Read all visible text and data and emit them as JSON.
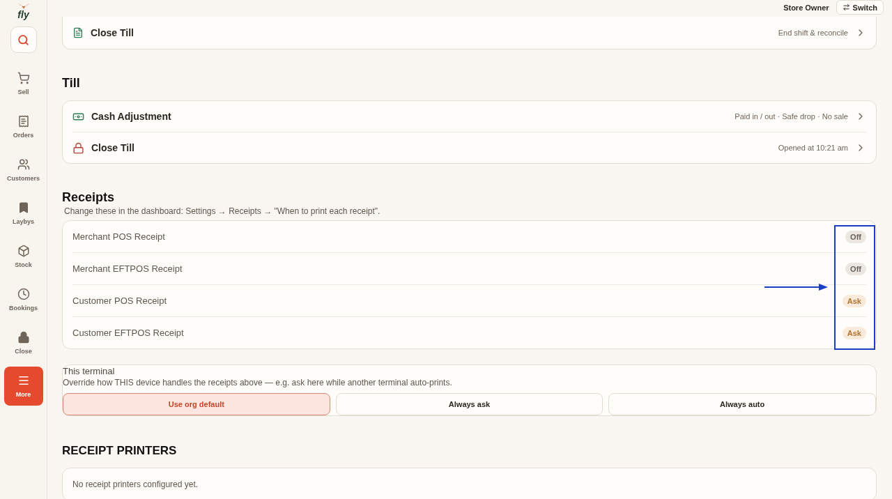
{
  "sidebar": {
    "logo": "fly",
    "items": [
      {
        "label": "Sell",
        "selected": false
      },
      {
        "label": "Orders",
        "selected": false
      },
      {
        "label": "Customers",
        "selected": false
      },
      {
        "label": "Laybys",
        "selected": false
      },
      {
        "label": "Stock",
        "selected": false
      },
      {
        "label": "Bookings",
        "selected": false
      },
      {
        "label": "Close",
        "selected": false
      },
      {
        "label": "More",
        "selected": true
      }
    ]
  },
  "topbar": {
    "user": "Store Owner",
    "switch_button": "Switch"
  },
  "top_card": {
    "title": "Close Till",
    "detail": "End shift & reconcile"
  },
  "till": {
    "heading": "Till",
    "rows": [
      {
        "title": "Cash Adjustment",
        "detail": "Paid in / out · Safe drop · No sale"
      },
      {
        "title": "Close Till",
        "detail": "Opened at 10:21 am"
      }
    ]
  },
  "receipts": {
    "heading": "Receipts",
    "note": "Change these in the dashboard: Settings → Receipts → \"When to print each receipt\".",
    "rows": [
      {
        "label": "Merchant POS Receipt",
        "status": "Off",
        "kind": "off"
      },
      {
        "label": "Merchant EFTPOS Receipt",
        "status": "Off",
        "kind": "off"
      },
      {
        "label": "Customer POS Receipt",
        "status": "Ask",
        "kind": "ask"
      },
      {
        "label": "Customer EFTPOS Receipt",
        "status": "Ask",
        "kind": "ask"
      }
    ]
  },
  "terminal": {
    "title": "This terminal",
    "description": "Override how THIS device handles the receipts above — e.g. ask here while another terminal auto-prints.",
    "options": [
      {
        "label": "Use org default",
        "selected": true
      },
      {
        "label": "Always ask",
        "selected": false
      },
      {
        "label": "Always auto",
        "selected": false
      }
    ]
  },
  "printers": {
    "heading": "RECEIPT PRINTERS",
    "empty": "No receipt printers configured yet."
  }
}
